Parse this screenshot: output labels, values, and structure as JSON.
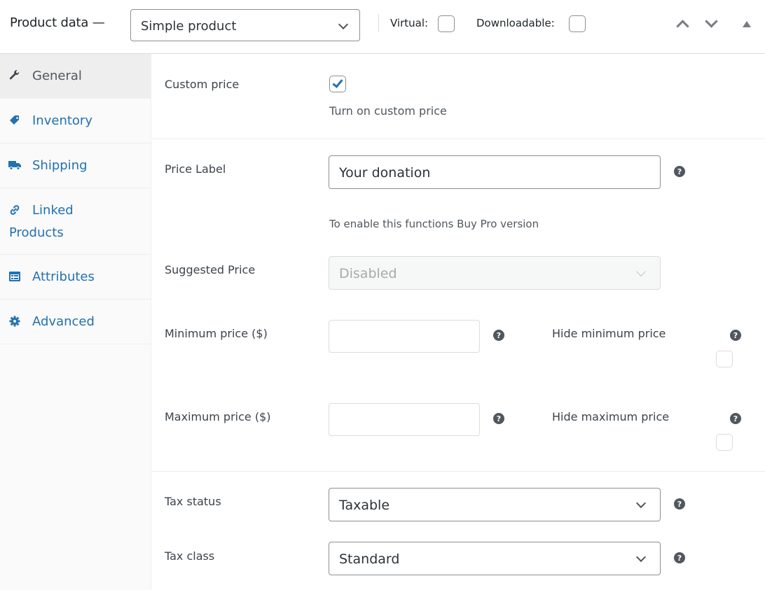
{
  "header": {
    "title": "Product data —",
    "product_type": "Simple product",
    "virtual_label": "Virtual:",
    "virtual_checked": false,
    "downloadable_label": "Downloadable:",
    "downloadable_checked": false
  },
  "sidebar": {
    "tabs": [
      {
        "label": "General",
        "icon": "wrench-icon",
        "active": true
      },
      {
        "label": "Inventory",
        "icon": "tag-icon",
        "active": false
      },
      {
        "label": "Shipping",
        "icon": "truck-icon",
        "active": false
      },
      {
        "label_line1": "Linked",
        "label_line2": "Products",
        "icon": "link-icon",
        "active": false
      },
      {
        "label": "Attributes",
        "icon": "list-icon",
        "active": false
      },
      {
        "label": "Advanced",
        "icon": "gear-icon",
        "active": false
      }
    ]
  },
  "fields": {
    "custom_price": {
      "label": "Custom price",
      "checked": true,
      "description": "Turn on custom price"
    },
    "price_label": {
      "label": "Price Label",
      "value": "Your donation",
      "help": "?"
    },
    "pro_notice": "To enable this functions Buy Pro version",
    "suggested_price": {
      "label": "Suggested Price",
      "value": "Disabled"
    },
    "minimum_price": {
      "label": "Minimum price ($)",
      "value": "",
      "help": "?",
      "hide_label": "Hide minimum price",
      "hide_checked": false
    },
    "maximum_price": {
      "label": "Maximum price ($)",
      "value": "",
      "help": "?",
      "hide_label": "Hide maximum price",
      "hide_checked": false
    },
    "tax_status": {
      "label": "Tax status",
      "value": "Taxable",
      "help": "?"
    },
    "tax_class": {
      "label": "Tax class",
      "value": "Standard",
      "help": "?"
    }
  },
  "colors": {
    "accent": "#2271b1",
    "text": "#3c434a",
    "tab_active_bg": "#eeeeee"
  }
}
